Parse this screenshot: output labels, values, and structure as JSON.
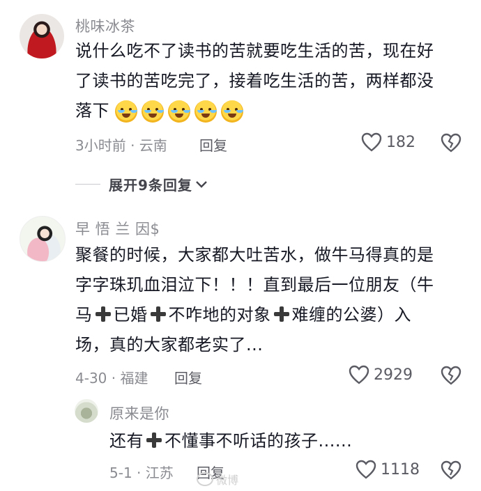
{
  "comments": [
    {
      "username": "桃味冰茶",
      "lines": [
        "说什么吃不了读书的苦就要吃生活的苦，现在好",
        "了读书的苦吃完了，接着吃生活的苦，两样都没",
        "落下"
      ],
      "emoji_count": 5,
      "time_location": "3小时前 · 云南",
      "reply_label": "回复",
      "likes": "182"
    },
    {
      "username": "早 悟  兰 因$",
      "lines": [
        "聚餐的时候，大家都大吐苦水，做牛马得真的是",
        "字字珠玑血泪泣下！！！直到最后一位朋友（牛"
      ],
      "line3": {
        "a": "马",
        "b": "已婚",
        "c": "不咋地的对象",
        "d": "难缠的公婆）入"
      },
      "line4": "场，真的大家都老实了...",
      "time_location": "4-30 · 福建",
      "reply_label": "回复",
      "likes": "2929"
    },
    {
      "username": "原来是你",
      "text_a": "还有",
      "text_b": "不懂事不听话的孩子......",
      "time_location": "5-1 · 江苏",
      "reply_label": "回复",
      "likes": "1118"
    }
  ],
  "expand_replies": {
    "label": "展开9条回复"
  },
  "watermark": {
    "text": "微博"
  },
  "colors": {
    "text": "#161823",
    "secondary": "#8a8b91",
    "emoji": "#ffd84a"
  },
  "icons": [
    "heart-outline-icon",
    "broken-heart-icon",
    "chevron-down-icon",
    "plus-emoji-icon",
    "loudly-crying-emoji-icon"
  ]
}
